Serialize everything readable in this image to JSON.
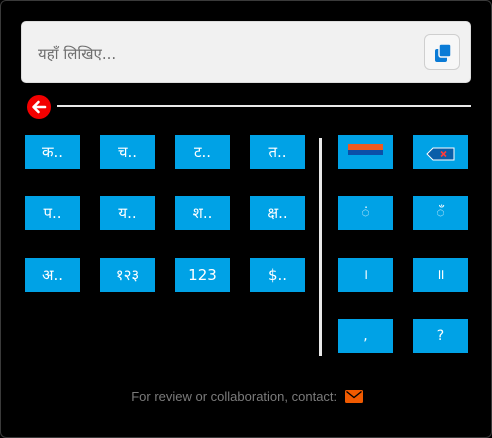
{
  "input": {
    "placeholder": "यहाँ लिखिए..."
  },
  "icons": {
    "copy": "copy-icon",
    "back": "arrow-left-icon",
    "space": "space-bar-icon",
    "backspace": "backspace-icon",
    "mail": "mail-icon"
  },
  "colors": {
    "key": "#00a2e6",
    "back_button": "#f30000",
    "mail_icon": "#f05a00",
    "input_bg": "#f1f1f1"
  },
  "left_keys": [
    {
      "label": "क.."
    },
    {
      "label": "च.."
    },
    {
      "label": "ट.."
    },
    {
      "label": "त.."
    },
    {
      "label": "प.."
    },
    {
      "label": "य.."
    },
    {
      "label": "श.."
    },
    {
      "label": "क्ष.."
    },
    {
      "label": "अ.."
    },
    {
      "label": "१२३"
    },
    {
      "label": "123"
    },
    {
      "label": "$.."
    }
  ],
  "right_keys": {
    "anusvara": "ं",
    "chandrabindu": "ँ",
    "danda": "।",
    "double_danda": "॥",
    "comma": ",",
    "question": "?"
  },
  "footer": {
    "text": "For review or collaboration, contact:"
  }
}
